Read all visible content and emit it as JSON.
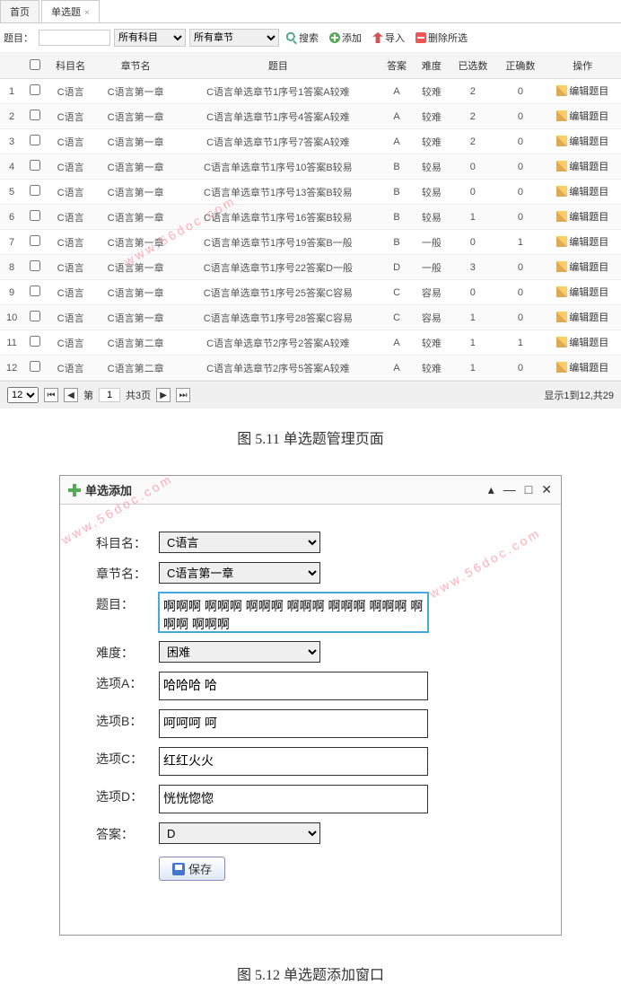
{
  "tabs": [
    {
      "label": "首页",
      "closable": false
    },
    {
      "label": "单选题",
      "closable": true
    }
  ],
  "toolbar": {
    "label": "题目：",
    "subject_sel": "所有科目",
    "chapter_sel": "所有章节",
    "btn_search": "搜索",
    "btn_add": "添加",
    "btn_import": "导入",
    "btn_delete": "删除所选"
  },
  "table": {
    "headers": [
      "",
      "",
      "科目名",
      "章节名",
      "题目",
      "答案",
      "难度",
      "已选数",
      "正确数",
      "操作"
    ],
    "edit_label": "编辑题目",
    "rows": [
      {
        "n": "1",
        "subject": "C语言",
        "chapter": "C语言第一章",
        "title": "C语言单选章节1序号1答案A较难",
        "ans": "A",
        "diff": "较难",
        "sel": "2",
        "cor": "0"
      },
      {
        "n": "2",
        "subject": "C语言",
        "chapter": "C语言第一章",
        "title": "C语言单选章节1序号4答案A较难",
        "ans": "A",
        "diff": "较难",
        "sel": "2",
        "cor": "0"
      },
      {
        "n": "3",
        "subject": "C语言",
        "chapter": "C语言第一章",
        "title": "C语言单选章节1序号7答案A较难",
        "ans": "A",
        "diff": "较难",
        "sel": "2",
        "cor": "0"
      },
      {
        "n": "4",
        "subject": "C语言",
        "chapter": "C语言第一章",
        "title": "C语言单选章节1序号10答案B较易",
        "ans": "B",
        "diff": "较易",
        "sel": "0",
        "cor": "0"
      },
      {
        "n": "5",
        "subject": "C语言",
        "chapter": "C语言第一章",
        "title": "C语言单选章节1序号13答案B较易",
        "ans": "B",
        "diff": "较易",
        "sel": "0",
        "cor": "0"
      },
      {
        "n": "6",
        "subject": "C语言",
        "chapter": "C语言第一章",
        "title": "C语言单选章节1序号16答案B较易",
        "ans": "B",
        "diff": "较易",
        "sel": "1",
        "cor": "0"
      },
      {
        "n": "7",
        "subject": "C语言",
        "chapter": "C语言第一章",
        "title": "C语言单选章节1序号19答案B一般",
        "ans": "B",
        "diff": "一般",
        "sel": "0",
        "cor": "1"
      },
      {
        "n": "8",
        "subject": "C语言",
        "chapter": "C语言第一章",
        "title": "C语言单选章节1序号22答案D一般",
        "ans": "D",
        "diff": "一般",
        "sel": "3",
        "cor": "0"
      },
      {
        "n": "9",
        "subject": "C语言",
        "chapter": "C语言第一章",
        "title": "C语言单选章节1序号25答案C容易",
        "ans": "C",
        "diff": "容易",
        "sel": "0",
        "cor": "0"
      },
      {
        "n": "10",
        "subject": "C语言",
        "chapter": "C语言第一章",
        "title": "C语言单选章节1序号28答案C容易",
        "ans": "C",
        "diff": "容易",
        "sel": "1",
        "cor": "0"
      },
      {
        "n": "11",
        "subject": "C语言",
        "chapter": "C语言第二章",
        "title": "C语言单选章节2序号2答案A较难",
        "ans": "A",
        "diff": "较难",
        "sel": "1",
        "cor": "1"
      },
      {
        "n": "12",
        "subject": "C语言",
        "chapter": "C语言第二章",
        "title": "C语言单选章节2序号5答案A较难",
        "ans": "A",
        "diff": "较难",
        "sel": "1",
        "cor": "0"
      }
    ]
  },
  "pager": {
    "page_size": "12",
    "page_label_prefix": "第",
    "page_value": "1",
    "page_total": "共3页",
    "status": "显示1到12,共29"
  },
  "caption1": "图 5.11 单选题管理页面",
  "caption2": "图 5.12  单选题添加窗口",
  "watermark": "www.56doc.com",
  "dialog": {
    "title": "单选添加",
    "labels": {
      "subject": "科目名：",
      "chapter": "章节名：",
      "question": "题目：",
      "difficulty": "难度：",
      "optA": "选项A：",
      "optB": "选项B：",
      "optC": "选项C：",
      "optD": "选项D：",
      "answer": "答案："
    },
    "values": {
      "subject": "C语言",
      "chapter": "C语言第一章",
      "question": "啊啊啊 啊啊啊 啊啊啊 啊啊啊 啊啊啊 啊啊啊 啊啊啊 啊啊啊",
      "difficulty": "困难",
      "optA": "哈哈哈 哈",
      "optB": "呵呵呵 呵",
      "optC": "红红火火",
      "optD": "恍恍惚惚",
      "answer": "D"
    },
    "save": "保存"
  }
}
